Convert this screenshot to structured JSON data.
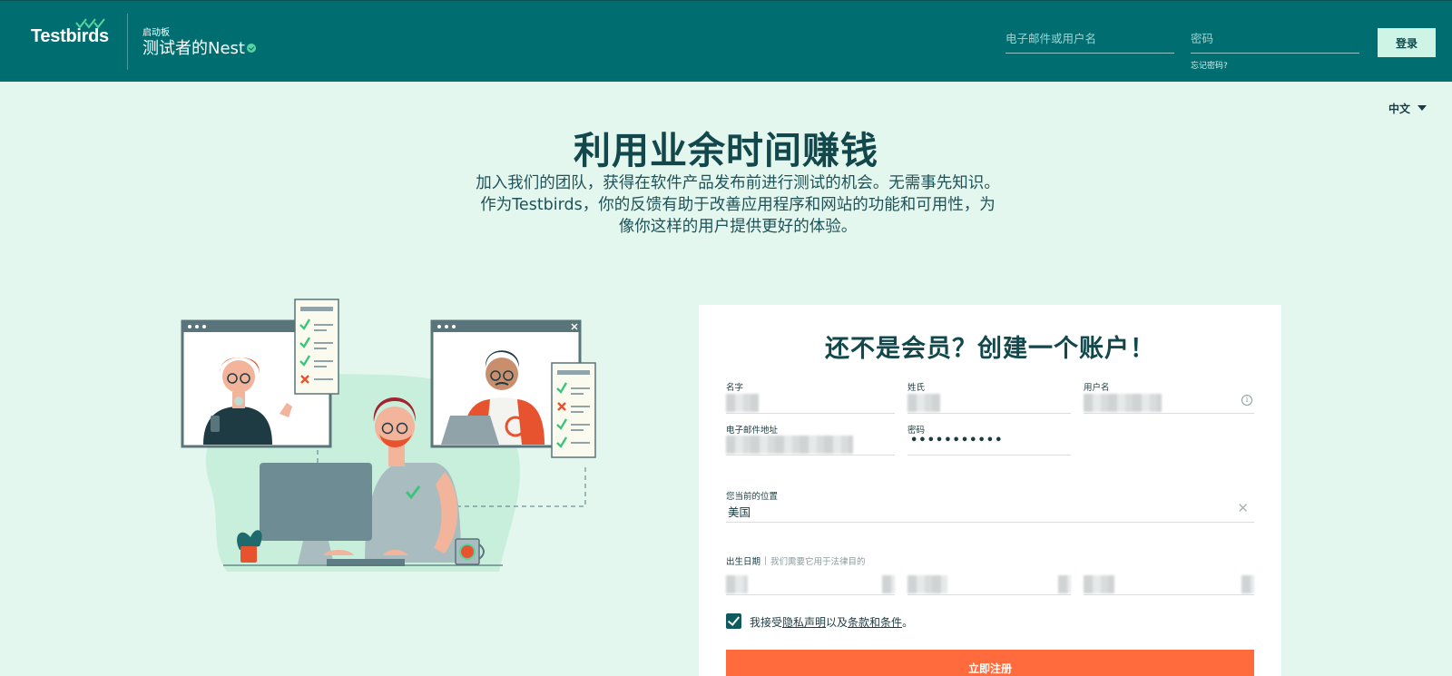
{
  "header": {
    "brand": "Testbirds",
    "launch_label": "启动板",
    "product_name": "测试者的Nest",
    "email_placeholder": "电子邮件或用户名",
    "password_placeholder": "密码",
    "forgot_password": "忘记密码?",
    "login_label": "登录"
  },
  "language": {
    "selected": "中文"
  },
  "hero": {
    "title": "利用业余时间赚钱",
    "text": "加入我们的团队，获得在软件产品发布前进行测试的机会。无需事先知识。作为Testbirds，你的反馈有助于改善应用程序和网站的功能和可用性，为像你这样的用户提供更好的体验。"
  },
  "form": {
    "title": "还不是会员？创建一个账户！",
    "first_name_label": "名字",
    "last_name_label": "姓氏",
    "username_label": "用户名",
    "email_label": "电子邮件地址",
    "password_label": "密码",
    "password_value": "•••••••••••",
    "location_label": "您当前的位置",
    "location_value": "美国",
    "dob_label": "出生日期",
    "dob_hint": "我们需要它用于法律目的",
    "accept_prefix": "我接受",
    "privacy_link": "隐私声明",
    "accept_middle": "以及",
    "terms_link": "条款和条件",
    "accept_suffix": "。",
    "submit_label": "立即注册"
  },
  "colors": {
    "header_bg": "#006e71",
    "page_bg": "#e3f7ef",
    "submit_bg": "#ff6b3d",
    "accent_green": "#3cc47c"
  }
}
